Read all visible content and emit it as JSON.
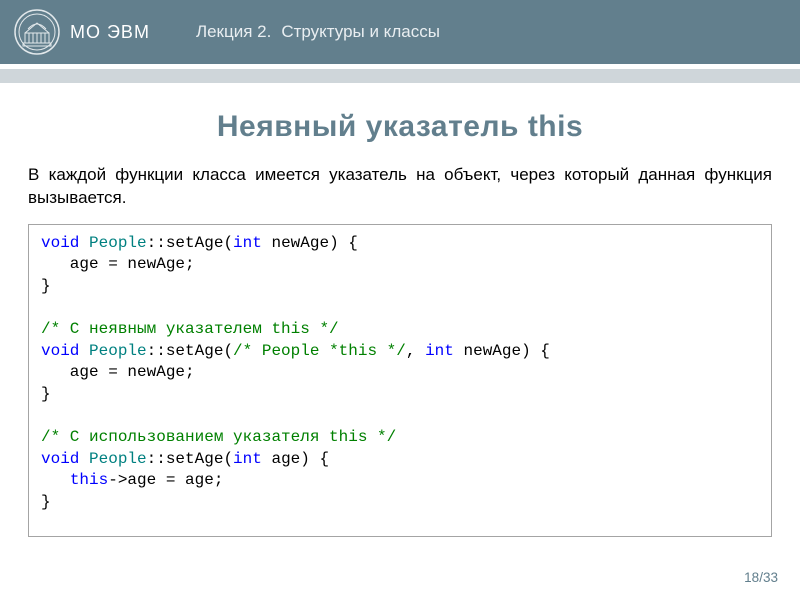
{
  "header": {
    "org": "МО ЭВМ",
    "lecture_num": "Лекция 2.",
    "lecture_title": "Структуры и классы"
  },
  "slide": {
    "title": "Неявный указатель this",
    "intro": "В каждой функции класса имеется указатель на объект, через который данная функция вызывается."
  },
  "code": {
    "l01_kw": "void ",
    "l01_ty": "People",
    "l01_rest": "::setAge(",
    "l01_kw2": "int",
    "l01_rest2": " newAge) {",
    "l02": "   age = newAge;",
    "l03": "}",
    "blank1": "",
    "l05_cm": "/* C неявным указателем this */",
    "l06_kw": "void ",
    "l06_ty": "People",
    "l06_rest": "::setAge(",
    "l06_cm": "/* People *this */",
    "l06_rest2": ", ",
    "l06_kw2": "int",
    "l06_rest3": " newAge) {",
    "l07": "   age = newAge;",
    "l08": "}",
    "blank2": "",
    "l10_cm": "/* C использованием указателя this */",
    "l11_kw": "void ",
    "l11_ty": "People",
    "l11_rest": "::setAge(",
    "l11_kw2": "int",
    "l11_rest2": " age) {",
    "l12_a": "   ",
    "l12_kw": "this",
    "l12_b": "->age = age;",
    "l13": "}"
  },
  "footer": {
    "page": "18",
    "sep": "/",
    "total": "33"
  }
}
